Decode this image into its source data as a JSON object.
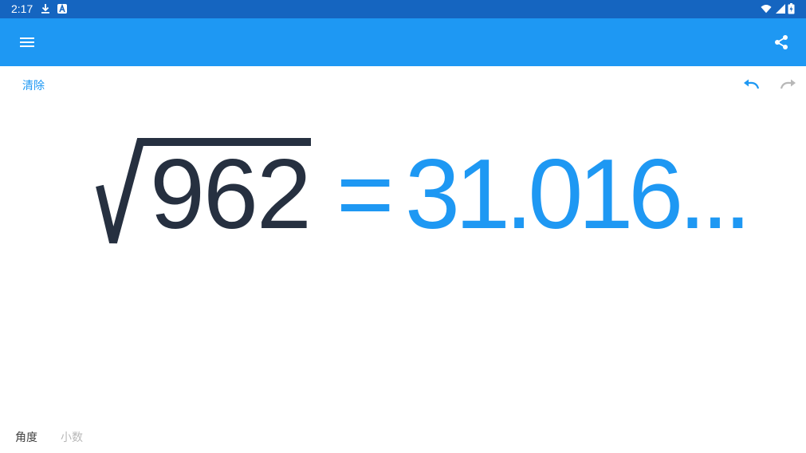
{
  "status_bar": {
    "time": "2:17",
    "left_icons": [
      "download-icon",
      "a-icon"
    ],
    "right_icons": [
      "wifi-icon",
      "signal-icon",
      "battery-icon"
    ],
    "background": "#1565c0"
  },
  "app_bar": {
    "menu_icon": "menu-icon",
    "share_icon": "share-icon",
    "background": "#1e98f3"
  },
  "toolbar": {
    "clear_label": "清除",
    "undo_icon": "undo-icon",
    "redo_icon": "redo-icon"
  },
  "display": {
    "expression": "962",
    "operator": "√",
    "equals": "=",
    "result": "31.016..."
  },
  "modes": {
    "angle_label": "角度",
    "decimal_label": "小数"
  },
  "colors": {
    "accent": "#1e98f3",
    "expression_text": "#263040",
    "inactive": "#b8b8b8"
  }
}
